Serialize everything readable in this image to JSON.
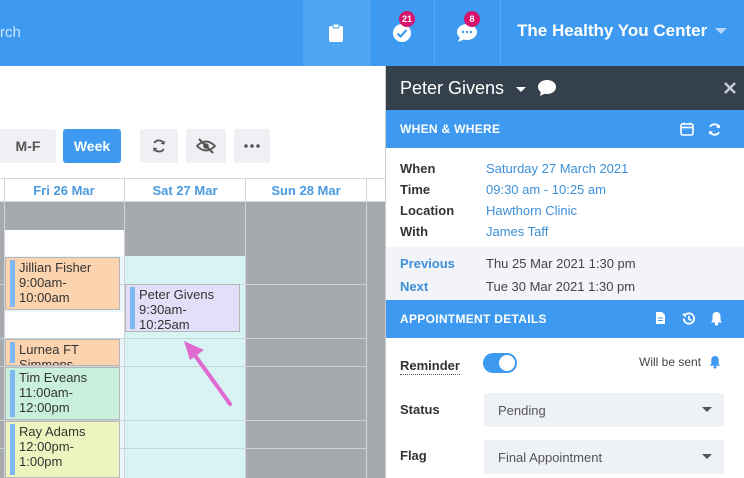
{
  "topbar": {
    "search_text": "rch",
    "tasks_badge": "21",
    "messages_badge": "8",
    "org_name": "The Healthy You Center"
  },
  "toolbar": {
    "mf_label": "M-F",
    "week_label": "Week"
  },
  "calendar": {
    "days": [
      "Fri 26 Mar",
      "Sat 27 Mar",
      "Sun 28 Mar"
    ],
    "appointments": [
      {
        "name": "Jillian Fisher",
        "time1": "9:00am-",
        "time2": "10:00am"
      },
      {
        "name": "Peter Givens",
        "time1": "9:30am-",
        "time2": "10:25am"
      },
      {
        "name": "Lurnea FT",
        "time1": "Simmons",
        "time2": ""
      },
      {
        "name": "Tim Eveans",
        "time1": "11:00am-",
        "time2": "12:00pm"
      },
      {
        "name": "Ray Adams",
        "time1": "12:00pm-",
        "time2": "1:00pm"
      }
    ]
  },
  "panel": {
    "client_name": "Peter Givens",
    "when_where_title": "WHEN & WHERE",
    "when_label": "When",
    "when_value": "Saturday 27 March 2021",
    "time_label": "Time",
    "time_value": "09:30 am - 10:25 am",
    "location_label": "Location",
    "location_value": "Hawthorn Clinic",
    "with_label": "With",
    "with_value": "James Taff",
    "previous_label": "Previous",
    "previous_value": "Thu 25 Mar 2021 1:30 pm",
    "next_label": "Next",
    "next_value": "Tue 30 Mar 2021 1:30 pm",
    "details_title": "APPOINTMENT DETAILS",
    "reminder_label": "Reminder",
    "reminder_status": "Will be sent",
    "status_label": "Status",
    "status_value": "Pending",
    "flag_label": "Flag",
    "flag_value": "Final Appointment"
  },
  "colors": {
    "accent": "#3d9af0",
    "panel_header": "#35404d",
    "badge": "#d6146b",
    "arrow": "#e06ad0"
  }
}
